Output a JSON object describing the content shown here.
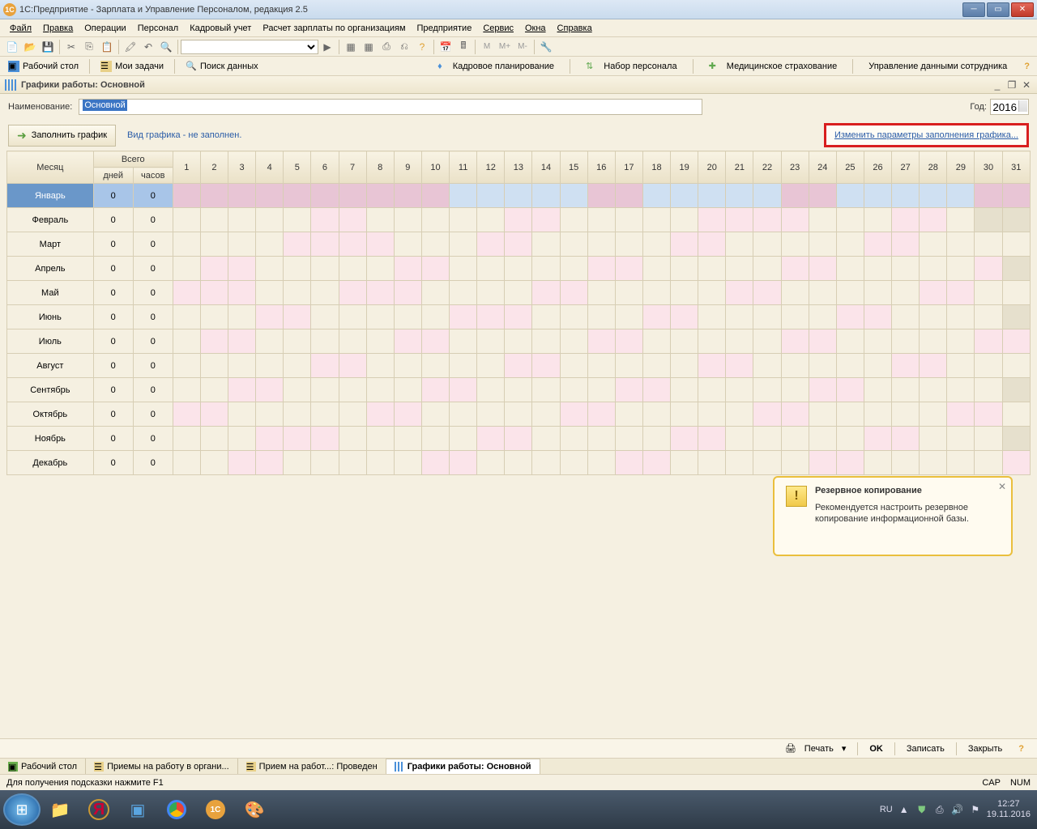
{
  "title": "1С:Предприятие - Зарплата и Управление Персоналом, редакция 2.5",
  "menu": [
    "Файл",
    "Правка",
    "Операции",
    "Персонал",
    "Кадровый учет",
    "Расчет зарплаты по организациям",
    "Предприятие",
    "Сервис",
    "Окна",
    "Справка"
  ],
  "toolbar2": {
    "desktop": "Рабочий стол",
    "tasks": "Мои задачи",
    "search": "Поиск данных",
    "kadr": "Кадровое планирование",
    "nabor": "Набор персонала",
    "med": "Медицинское страхование",
    "upr": "Управление данными сотрудника"
  },
  "doc_title": "Графики работы: Основной",
  "form": {
    "name_label": "Наименование:",
    "name_value": "Основной",
    "year_label": "Год:",
    "year_value": "2016",
    "fill_button": "Заполнить график",
    "hint": "Вид графика - не заполнен.",
    "change_link": "Изменить параметры заполнения графика..."
  },
  "table": {
    "month_header": "Месяц",
    "total_header": "Всего",
    "days_header": "дней",
    "hours_header": "часов",
    "months": [
      "Январь",
      "Февраль",
      "Март",
      "Апрель",
      "Май",
      "Июнь",
      "Июль",
      "Август",
      "Сентябрь",
      "Октябрь",
      "Ноябрь",
      "Декабрь"
    ],
    "day_nums": [
      "1",
      "2",
      "3",
      "4",
      "5",
      "6",
      "7",
      "8",
      "9",
      "10",
      "11",
      "12",
      "13",
      "14",
      "15",
      "16",
      "17",
      "18",
      "19",
      "20",
      "21",
      "22",
      "23",
      "24",
      "25",
      "26",
      "27",
      "28",
      "29",
      "30",
      "31"
    ],
    "zero": "0"
  },
  "notif": {
    "title": "Резервное копирование",
    "body": "Рекомендуется настроить резервное копирование информационной базы."
  },
  "bottom": {
    "print": "Печать",
    "ok": "OK",
    "save": "Записать",
    "close": "Закрыть"
  },
  "tabs": [
    "Рабочий стол",
    "Приемы на работу в органи...",
    "Прием на работ...: Проведен",
    "Графики работы: Основной"
  ],
  "status": {
    "hint": "Для получения подсказки нажмите F1",
    "cap": "CAP",
    "num": "NUM"
  },
  "tray": {
    "lang": "RU",
    "time": "12:27",
    "date": "19.11.2016"
  }
}
